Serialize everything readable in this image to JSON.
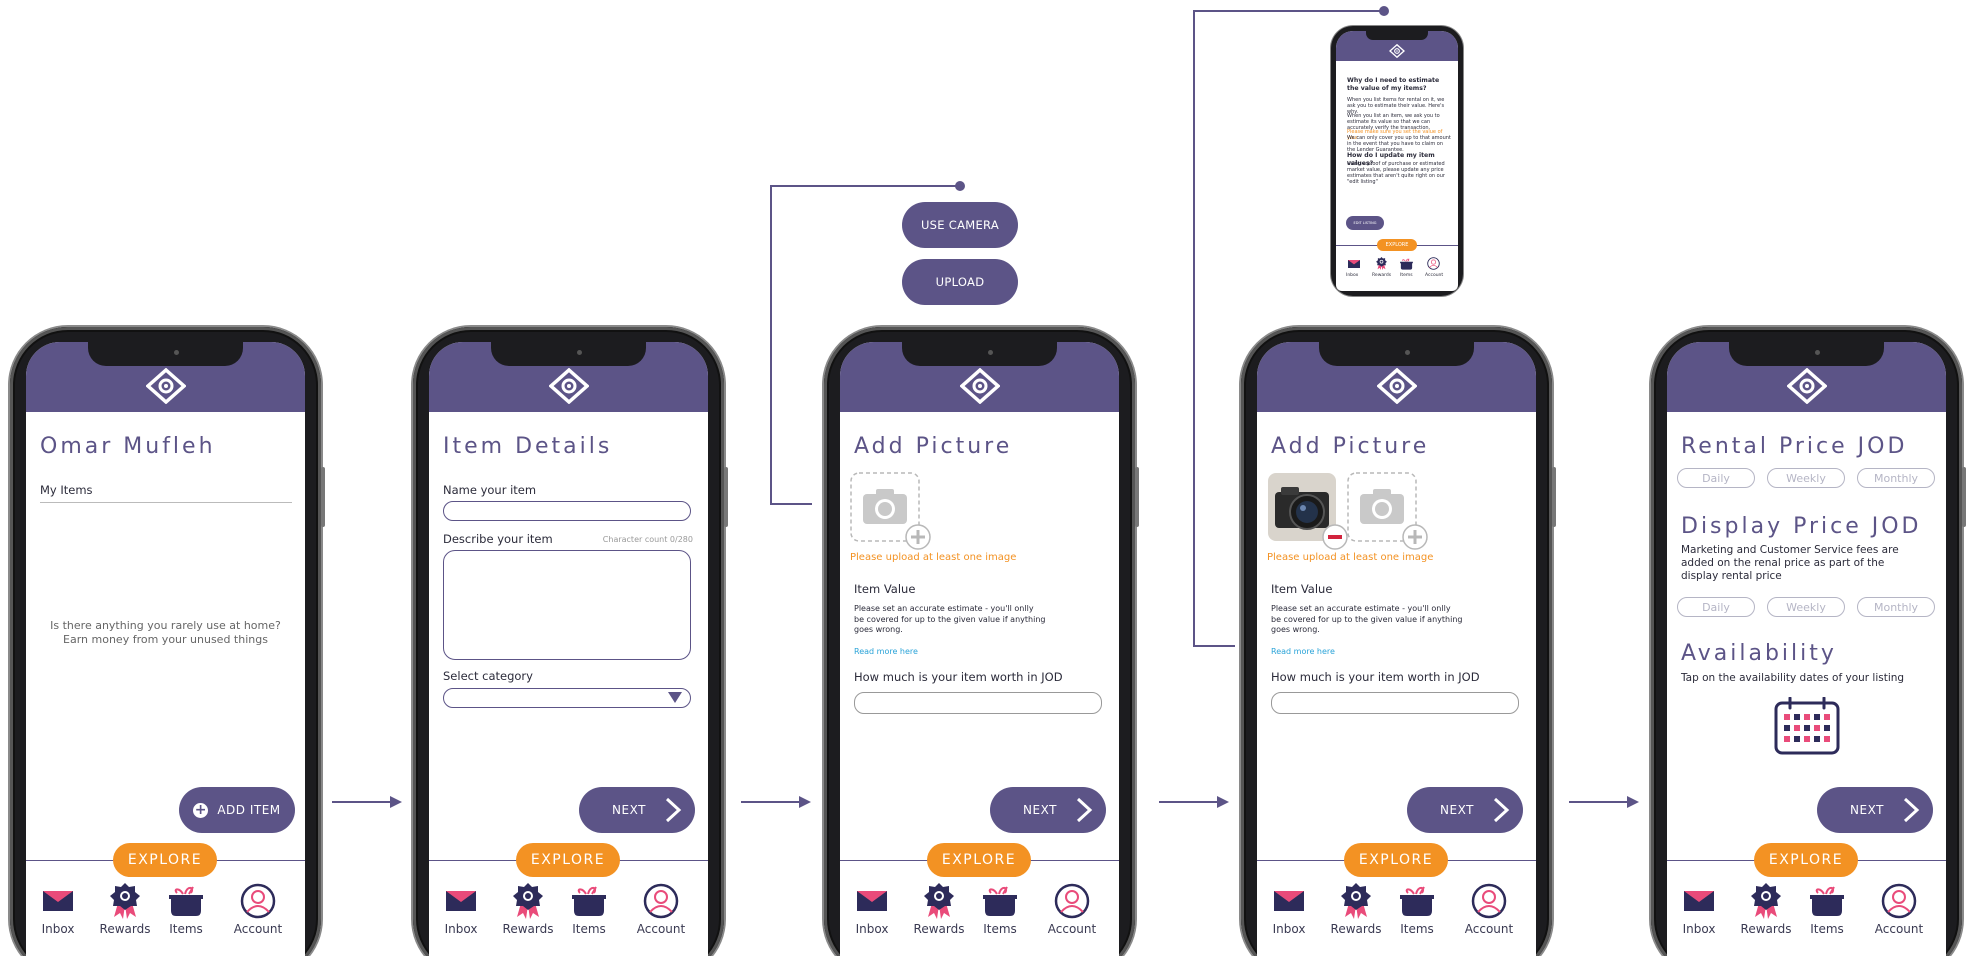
{
  "nav": {
    "inbox": "Inbox",
    "rewards": "Rewards",
    "items": "Items",
    "account": "Account"
  },
  "explore_label": "EXPLORE",
  "colors": {
    "primary": "#5c5487",
    "accent": "#f39223",
    "link": "#2aa3d8",
    "pink": "#e94b7a"
  },
  "screen1": {
    "title": "Omar Mufleh",
    "section": "My Items",
    "empty_line1": "Is there anything you rarely use at home?",
    "empty_line2": "Earn money from your unused things",
    "add_button": "ADD ITEM"
  },
  "screen2": {
    "title": "Item Details",
    "name_label": "Name your item",
    "describe_label": "Describe your item",
    "char_count": "Character count 0/280",
    "category_label": "Select category",
    "next": "NEXT"
  },
  "camera_options": {
    "use_camera": "USE CAMERA",
    "upload": "UPLOAD"
  },
  "screen3": {
    "title": "Add Picture",
    "upload_warning": "Please upload at least one image",
    "value_heading": "Item Value",
    "value_line1": "Please set an accurate estimate - you'll onlly",
    "value_line2": "be covered for up to the given value if anything",
    "value_line3": "goes wrong.",
    "read_more": "Read more here",
    "worth_label": "How much is your item worth in JOD",
    "next": "NEXT"
  },
  "screen4": {
    "title": "Add Picture",
    "upload_warning": "Please upload at least one image",
    "value_heading": "Item Value",
    "value_line1": "Please set an accurate estimate - you'll onlly",
    "value_line2": "be covered for up to the given value if anything",
    "value_line3": "goes wrong.",
    "read_more": "Read more here",
    "worth_label": "How much is your item worth in JOD",
    "next": "NEXT"
  },
  "mini": {
    "q1": "Why do I need to estimate the value of my items?",
    "p1": "When you list items for rental on it, we ask you to estimate their value. Here's why.",
    "p2": "When you list an item, we ask you to estimate its value so that we can accurately verify the transaction.",
    "p3_orange": "Please make sure you set the value of your",
    "p3": "We can only cover you up to that amount in the event that you have to claim on the Lender Guarantee.",
    "q2": "How do I update my item values?",
    "p4": "Using a proof of purchase or estimated market value, please update any price estimates that aren't quite right on our \"edit listing\"",
    "back": "EDIT LISTING",
    "explore": "EXPLORE",
    "nav_inbox": "Inbox",
    "nav_rewards": "Rewards",
    "nav_items": "Items",
    "nav_account": "Account"
  },
  "screen5": {
    "title": "Rental Price JOD",
    "rental_options": [
      "Daily",
      "Weekly",
      "Monthly"
    ],
    "display_title": "Display Price JOD",
    "display_line1": "Marketing and Customer Service fees are",
    "display_line2": "added on the renal price as part of the",
    "display_line3": "display rental price",
    "display_options": [
      "Daily",
      "Weekly",
      "Monthly"
    ],
    "availability_title": "Availability",
    "availability_text": "Tap on the availability dates of your listing",
    "next": "NEXT"
  }
}
